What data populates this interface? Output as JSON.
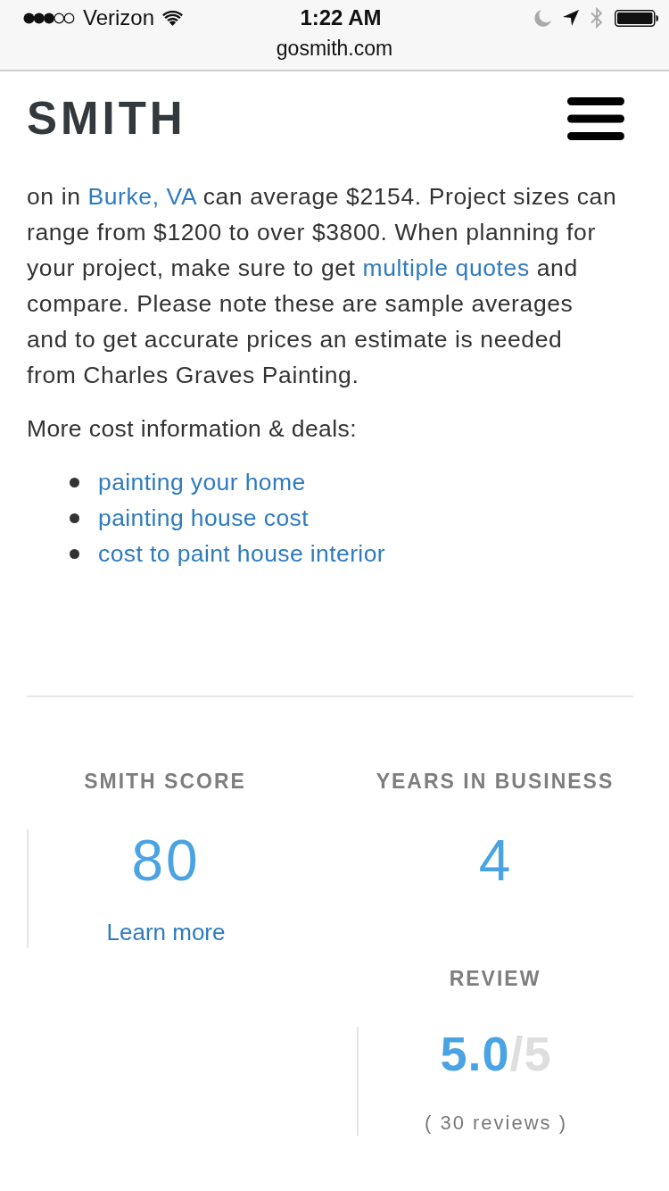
{
  "status_bar": {
    "carrier": "Verizon",
    "time": "1:22 AM",
    "url": "gosmith.com"
  },
  "header": {
    "logo": "SMITH"
  },
  "article": {
    "paragraph": [
      {
        "kind": "text",
        "text": "on in "
      },
      {
        "kind": "link",
        "text": "Burke, VA"
      },
      {
        "kind": "text",
        "text": " can average $2154. Project sizes can\nrange from $1200 to over $3800. When planning for\nyour project, make sure to get "
      },
      {
        "kind": "link",
        "text": "multiple quotes"
      },
      {
        "kind": "text",
        "text": " and\ncompare. Please note these are sample averages\nand to get accurate prices an estimate is needed\nfrom Charles Graves Painting."
      }
    ],
    "more_heading": "More cost information & deals:",
    "links": [
      "painting your home",
      "painting house cost",
      "cost to paint house interior"
    ]
  },
  "stats": [
    {
      "kind": "score",
      "label": "SMITH SCORE",
      "value": "80",
      "link": "Learn more"
    },
    {
      "kind": "count",
      "label": "YEARS IN BUSINESS",
      "value": "4"
    },
    {
      "kind": "rating",
      "label": "REVIEW",
      "value": "5.0",
      "out_of": "/5",
      "note": "( 30 reviews )"
    }
  ]
}
